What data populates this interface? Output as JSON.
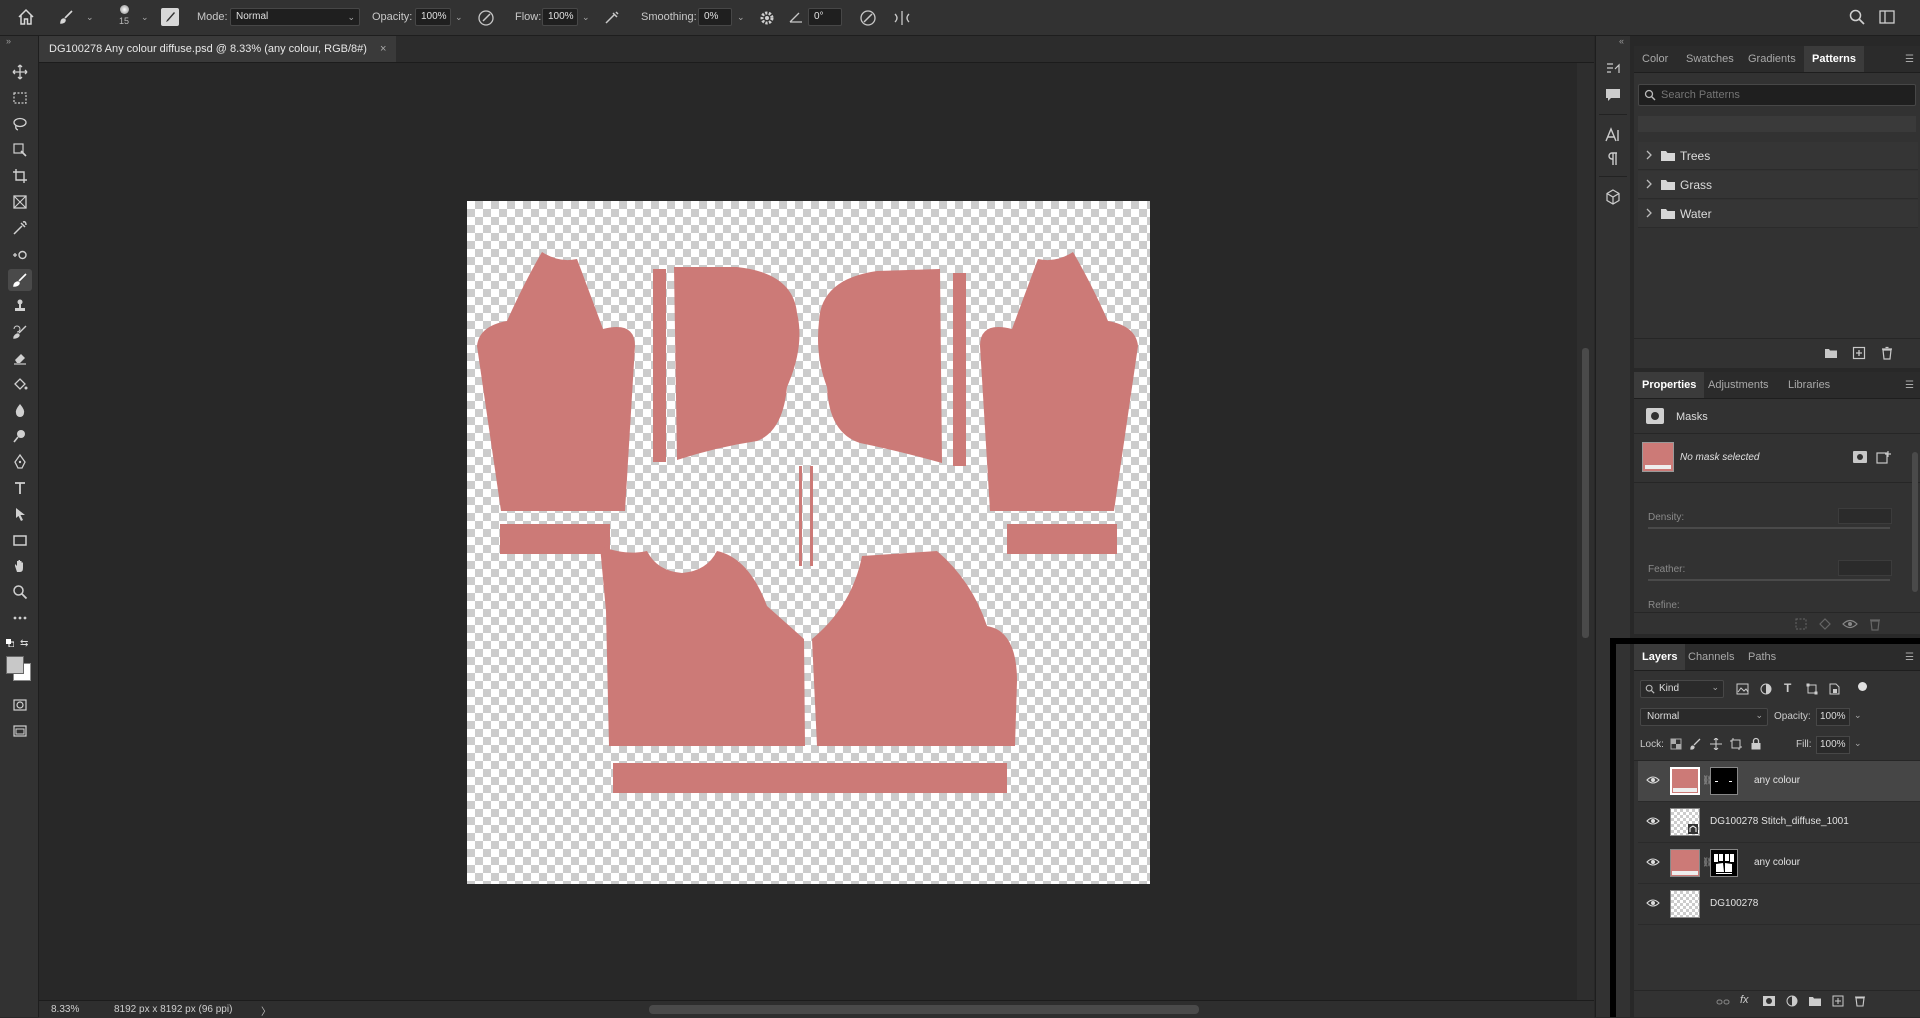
{
  "options_bar": {
    "brush_size": "15",
    "mode_label": "Mode:",
    "mode_value": "Normal",
    "opacity_label": "Opacity:",
    "opacity_value": "100%",
    "flow_label": "Flow:",
    "flow_value": "100%",
    "smoothing_label": "Smoothing:",
    "smoothing_value": "0%",
    "angle_value": "0°"
  },
  "document": {
    "tab_title": "DG100278 Any colour diffuse.psd @ 8.33% (any colour, RGB/8#)",
    "tab_close": "×",
    "fill_color": "#cc7a77"
  },
  "status": {
    "zoom": "8.33%",
    "doc_info": "8192 px x 8192 px (96 ppi)",
    "arrow": "〉"
  },
  "patterns_panel": {
    "tabs": [
      "Color",
      "Swatches",
      "Gradients",
      "Patterns"
    ],
    "active_tab": "Patterns",
    "search_placeholder": "Search Patterns",
    "groups": [
      "Trees",
      "Grass",
      "Water"
    ]
  },
  "properties_panel": {
    "tabs": [
      "Properties",
      "Adjustments",
      "Libraries"
    ],
    "active_tab": "Properties",
    "section_title": "Masks",
    "no_mask": "No mask selected",
    "density_label": "Density:",
    "feather_label": "Feather:",
    "refine_label": "Refine:"
  },
  "layers_panel": {
    "tabs": [
      "Layers",
      "Channels",
      "Paths"
    ],
    "active_tab": "Layers",
    "filter_kind": "Kind",
    "blend_mode": "Normal",
    "opacity_label": "Opacity:",
    "opacity_value": "100%",
    "lock_label": "Lock:",
    "fill_label": "Fill:",
    "fill_value": "100%",
    "layers": [
      {
        "name": "any colour",
        "selected": true
      },
      {
        "name": "DG100278 Stitch_diffuse_1001",
        "selected": false
      },
      {
        "name": "any colour",
        "selected": false
      },
      {
        "name": "DG100278",
        "selected": false
      }
    ]
  },
  "icons": {
    "home": "home-icon",
    "brush": "brush-icon",
    "settings": "gear-icon"
  }
}
